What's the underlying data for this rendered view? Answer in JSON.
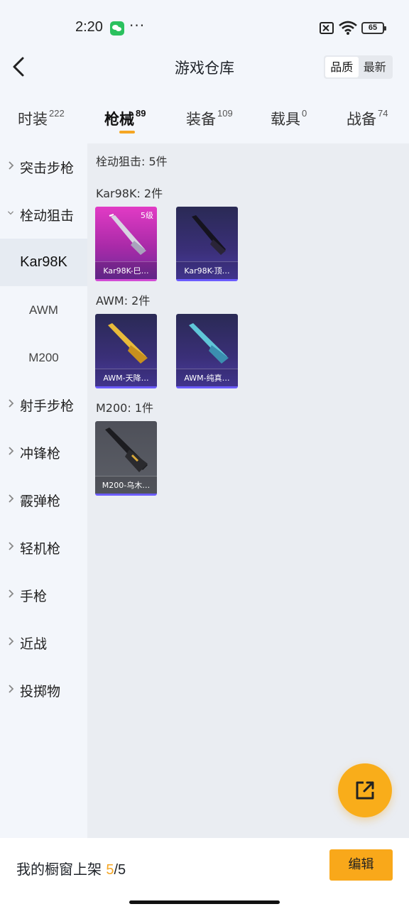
{
  "status_bar": {
    "time": "2:20",
    "more": "···",
    "battery": "65"
  },
  "header": {
    "title": "游戏仓库",
    "sort_options": [
      "品质",
      "最新"
    ],
    "active_sort": "品质"
  },
  "tabs": [
    {
      "label": "时装",
      "count": "222"
    },
    {
      "label": "枪械",
      "count": "89",
      "active": true
    },
    {
      "label": "装备",
      "count": "109"
    },
    {
      "label": "载具",
      "count": "0"
    },
    {
      "label": "战备",
      "count": "74"
    }
  ],
  "sidebar": {
    "items": [
      {
        "label": "突击步枪"
      },
      {
        "label": "栓动狙击",
        "expanded": true
      },
      {
        "label": "射手步枪"
      },
      {
        "label": "冲锋枪"
      },
      {
        "label": "霰弹枪"
      },
      {
        "label": "轻机枪"
      },
      {
        "label": "手枪"
      },
      {
        "label": "近战"
      },
      {
        "label": "投掷物"
      }
    ],
    "subitems": [
      {
        "label": "Kar98K",
        "active": true
      },
      {
        "label": "AWM"
      },
      {
        "label": "M200"
      }
    ]
  },
  "content": {
    "category_summary": "栓动狙击: 5件",
    "groups": [
      {
        "label": "Kar98K: 2件",
        "cards": [
          {
            "caption": "Kar98K-巳…",
            "level": "5级",
            "style": "pink",
            "gun_color": "#c9c4d6"
          },
          {
            "caption": "Kar98K-顶…",
            "style": "purple",
            "gun_color": "#1c1a28"
          }
        ]
      },
      {
        "label": "AWM: 2件",
        "cards": [
          {
            "caption": "AWM-天降…",
            "style": "purple",
            "gun_color": "#e5b83c"
          },
          {
            "caption": "AWM-纯真…",
            "style": "purple",
            "gun_color": "#5cc3d6"
          }
        ]
      },
      {
        "label": "M200: 1件",
        "cards": [
          {
            "caption": "M200-乌木…",
            "style": "gray",
            "gun_color": "#1e1e22"
          }
        ]
      }
    ]
  },
  "bottom_bar": {
    "label": "我的橱窗上架 ",
    "shelf_count": "5",
    "shelf_total": "/5",
    "edit_label": "编辑"
  },
  "colors": {
    "accent": "#f9ad1a",
    "card_border": "#6b5cff"
  }
}
